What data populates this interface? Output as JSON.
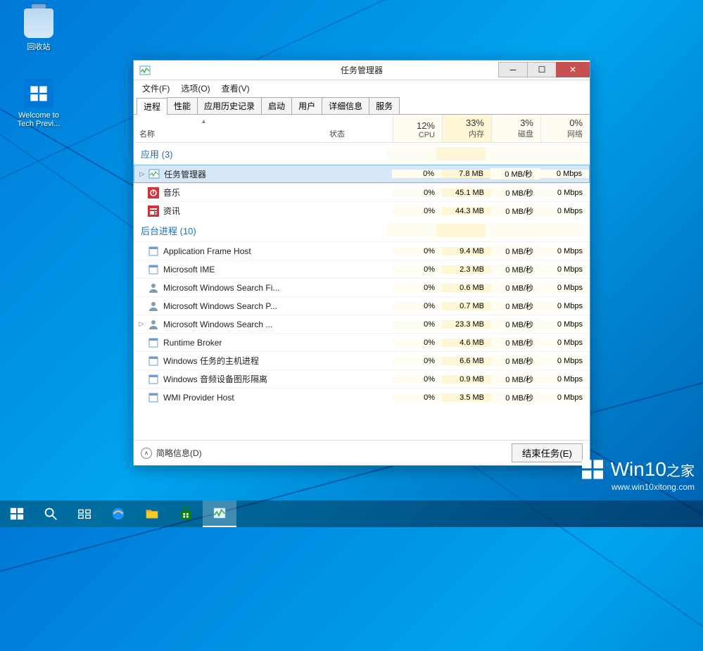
{
  "desktop": {
    "recycle_bin": "回收站",
    "welcome_tile": "Welcome to Tech Previ..."
  },
  "watermark": {
    "brand": "Win10",
    "suffix": "之家",
    "url": "www.win10xitong.com"
  },
  "tm": {
    "title": "任务管理器",
    "menu": {
      "file": "文件(F)",
      "options": "选项(O)",
      "view": "查看(V)"
    },
    "tabs": [
      "进程",
      "性能",
      "应用历史记录",
      "启动",
      "用户",
      "详细信息",
      "服务"
    ],
    "columns": {
      "name": "名称",
      "status": "状态",
      "cpu": {
        "pct": "12%",
        "lbl": "CPU"
      },
      "mem": {
        "pct": "33%",
        "lbl": "内存"
      },
      "disk": {
        "pct": "3%",
        "lbl": "磁盘"
      },
      "net": {
        "pct": "0%",
        "lbl": "网络"
      }
    },
    "groups": {
      "apps": "应用 (3)",
      "bg": "后台进程 (10)"
    },
    "apps": [
      {
        "name": "任务管理器",
        "cpu": "0%",
        "mem": "7.8 MB",
        "disk": "0 MB/秒",
        "net": "0 Mbps",
        "expandable": true,
        "selected": true
      },
      {
        "name": "音乐",
        "cpu": "0%",
        "mem": "45.1 MB",
        "disk": "0 MB/秒",
        "net": "0 Mbps"
      },
      {
        "name": "资讯",
        "cpu": "0%",
        "mem": "44.3 MB",
        "disk": "0 MB/秒",
        "net": "0 Mbps"
      }
    ],
    "bg": [
      {
        "name": "Application Frame Host",
        "cpu": "0%",
        "mem": "9.4 MB",
        "disk": "0 MB/秒",
        "net": "0 Mbps"
      },
      {
        "name": "Microsoft IME",
        "cpu": "0%",
        "mem": "2.3 MB",
        "disk": "0 MB/秒",
        "net": "0 Mbps"
      },
      {
        "name": "Microsoft Windows Search Fi...",
        "cpu": "0%",
        "mem": "0.6 MB",
        "disk": "0 MB/秒",
        "net": "0 Mbps"
      },
      {
        "name": "Microsoft Windows Search P...",
        "cpu": "0%",
        "mem": "0.7 MB",
        "disk": "0 MB/秒",
        "net": "0 Mbps"
      },
      {
        "name": "Microsoft Windows Search ...",
        "cpu": "0%",
        "mem": "23.3 MB",
        "disk": "0 MB/秒",
        "net": "0 Mbps",
        "expandable": true
      },
      {
        "name": "Runtime Broker",
        "cpu": "0%",
        "mem": "4.6 MB",
        "disk": "0 MB/秒",
        "net": "0 Mbps"
      },
      {
        "name": "Windows 任务的主机进程",
        "cpu": "0%",
        "mem": "6.6 MB",
        "disk": "0 MB/秒",
        "net": "0 Mbps"
      },
      {
        "name": "Windows 音频设备图形隔离",
        "cpu": "0%",
        "mem": "0.9 MB",
        "disk": "0 MB/秒",
        "net": "0 Mbps"
      },
      {
        "name": "WMI Provider Host",
        "cpu": "0%",
        "mem": "3.5 MB",
        "disk": "0 MB/秒",
        "net": "0 Mbps"
      }
    ],
    "footer": {
      "fewer": "简略信息(D)",
      "end_task": "结束任务(E)"
    }
  }
}
